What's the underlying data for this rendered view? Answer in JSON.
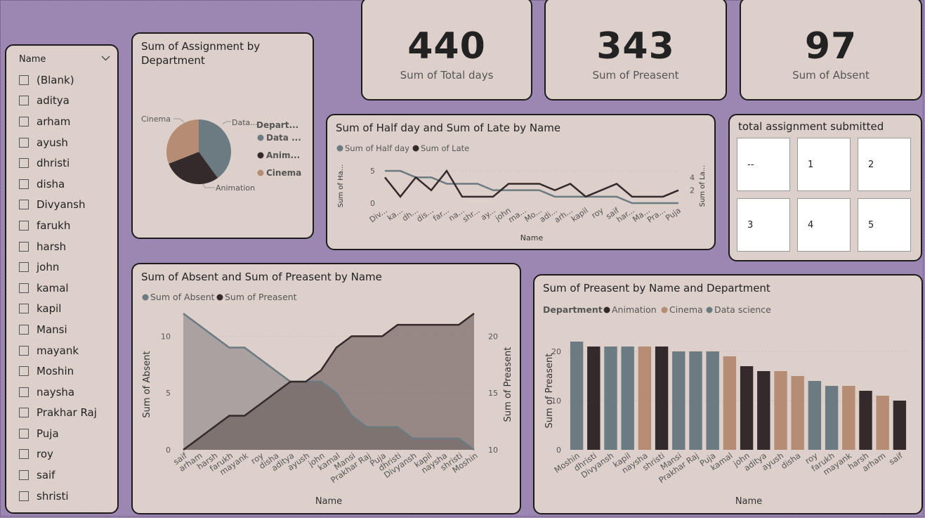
{
  "slicer": {
    "title": "Name",
    "items": [
      "(Blank)",
      "aditya",
      "arham",
      "ayush",
      "dhristi",
      "disha",
      "Divyansh",
      "farukh",
      "harsh",
      "john",
      "kamal",
      "kapil",
      "Mansi",
      "mayank",
      "Moshin",
      "naysha",
      "Prakhar Raj",
      "Puja",
      "roy",
      "saif",
      "shristi"
    ]
  },
  "kpis": [
    {
      "value": "440",
      "label": "Sum of Total days"
    },
    {
      "value": "343",
      "label": "Sum of Preasent"
    },
    {
      "value": "97",
      "label": "Sum of Absent"
    }
  ],
  "assignment_tiles": {
    "title": "total assignment submitted",
    "values": [
      "--",
      "1",
      "2",
      "3",
      "4",
      "5"
    ]
  },
  "colors": {
    "animation": "#352a2b",
    "cinema": "#b58d74",
    "data_science": "#6b7b81",
    "card_bg": "#ddd0cb",
    "page_bg": "#9b87b2"
  },
  "chart_data": [
    {
      "id": "pie",
      "type": "pie",
      "title": "Sum of Assignment by Department",
      "legend_title": "Depart...",
      "legend": [
        "Data ...",
        "Anim...",
        "Cinema"
      ],
      "slice_labels": [
        "Data...",
        "Animation",
        "Cinema"
      ],
      "categories": [
        "Data science",
        "Animation",
        "Cinema"
      ],
      "values": [
        40,
        29,
        31
      ]
    },
    {
      "id": "halflate",
      "type": "line",
      "title": "Sum of Half day and Sum of Late by Name",
      "xlabel": "Name",
      "ylabel_left": "Sum of Ha...",
      "ylabel_right": "Sum of La...",
      "categories": [
        "Div...",
        "ka...",
        "dh...",
        "dis...",
        "far...",
        "na...",
        "shr...",
        "ay...",
        "john",
        "ma...",
        "Mo...",
        "adi...",
        "arh...",
        "kapil",
        "roy",
        "saif",
        "har...",
        "Ma...",
        "Pra...",
        "Puja"
      ],
      "left_ticks": [
        0,
        5
      ],
      "right_ticks": [
        2,
        4
      ],
      "ylim_left": [
        0,
        6
      ],
      "ylim_right": [
        0,
        6
      ],
      "series": [
        {
          "name": "Sum of Half day",
          "axis": "left",
          "values": [
            5,
            5,
            4,
            4,
            3,
            3,
            3,
            2,
            2,
            2,
            2,
            1,
            1,
            1,
            1,
            1,
            0,
            0,
            0,
            0
          ]
        },
        {
          "name": "Sum of Late",
          "axis": "right",
          "values": [
            4,
            1,
            4,
            2,
            5,
            1,
            1,
            1,
            3,
            3,
            3,
            2,
            3,
            1,
            2,
            3,
            1,
            1,
            1,
            2
          ]
        }
      ]
    },
    {
      "id": "absentpresent",
      "type": "area",
      "title": "Sum of Absent and Sum of Preasent by Name",
      "xlabel": "Name",
      "ylabel_left": "Sum of Absent",
      "ylabel_right": "Sum of Preasent",
      "categories": [
        "saif",
        "arham",
        "harsh",
        "farukh",
        "mayank",
        "roy",
        "disha",
        "aditya",
        "ayush",
        "john",
        "kamal",
        "Mansi",
        "Prakhar Raj",
        "Puja",
        "dhristi",
        "Divyansh",
        "kapil",
        "naysha",
        "shristi",
        "Moshin"
      ],
      "left_ticks": [
        0,
        5,
        10
      ],
      "right_ticks": [
        10,
        15,
        20
      ],
      "ylim_left": [
        0,
        12
      ],
      "ylim_right": [
        10,
        22
      ],
      "series": [
        {
          "name": "Sum of Absent",
          "axis": "left",
          "values": [
            12,
            11,
            10,
            9,
            9,
            8,
            7,
            6,
            6,
            6,
            5,
            3,
            2,
            2,
            2,
            1,
            1,
            1,
            1,
            0
          ]
        },
        {
          "name": "Sum of Preasent",
          "axis": "right",
          "values": [
            10,
            11,
            12,
            13,
            13,
            14,
            15,
            16,
            16,
            17,
            19,
            20,
            20,
            20,
            21,
            21,
            21,
            21,
            21,
            22
          ]
        }
      ]
    },
    {
      "id": "presentdept",
      "type": "bar",
      "title": "Sum of Preasent by Name and Department",
      "legend_title": "Department",
      "legend": [
        "Animation",
        "Cinema",
        "Data science"
      ],
      "xlabel": "Name",
      "ylabel": "Sum of Preasent",
      "ticks": [
        0,
        10,
        20
      ],
      "ylim": [
        0,
        24
      ],
      "categories": [
        "Moshin",
        "dhristi",
        "Divyansh",
        "kapil",
        "naysha",
        "shristi",
        "Mansi",
        "Prakhar Raj",
        "Puja",
        "kamal",
        "john",
        "aditya",
        "ayush",
        "disha",
        "roy",
        "farukh",
        "mayank",
        "harsh",
        "arham",
        "saif"
      ],
      "values": [
        22,
        21,
        21,
        21,
        21,
        21,
        20,
        20,
        20,
        19,
        17,
        16,
        16,
        15,
        14,
        13,
        13,
        12,
        11,
        10
      ],
      "departments": [
        "Data science",
        "Animation",
        "Data science",
        "Data science",
        "Cinema",
        "Animation",
        "Data science",
        "Data science",
        "Data science",
        "Cinema",
        "Animation",
        "Animation",
        "Cinema",
        "Cinema",
        "Data science",
        "Data science",
        "Cinema",
        "Animation",
        "Cinema",
        "Animation"
      ]
    }
  ]
}
